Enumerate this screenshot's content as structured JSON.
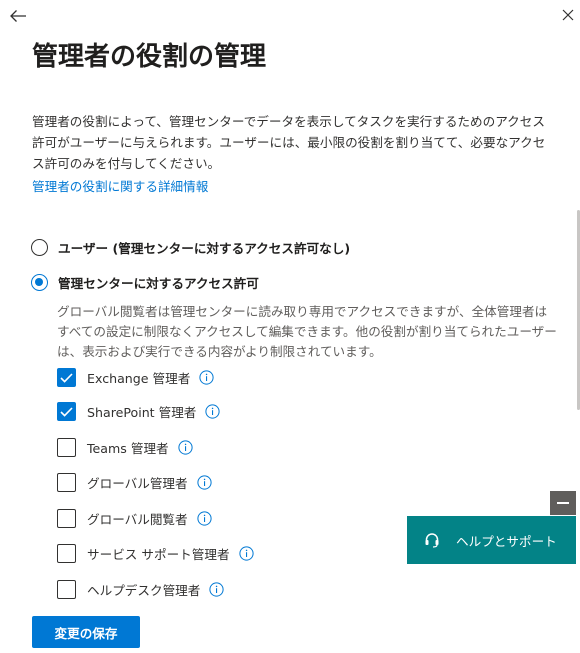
{
  "header": {
    "title": "管理者の役割の管理"
  },
  "description": "管理者の役割によって、管理センターでデータを表示してタスクを実行するためのアクセス許可がユーザーに与えられます。ユーザーには、最小限の役割を割り当てて、必要なアクセス許可のみを付与してください。",
  "learn_more_link": "管理者の役割に関する詳細情報",
  "options": {
    "user_label": "ユーザー (管理センターに対するアクセス許可なし)",
    "admin_label": "管理センターに対するアクセス許可",
    "selected": "admin"
  },
  "admin_description": "グローバル閲覧者は管理センターに読み取り専用でアクセスできますが、全体管理者はすべての設定に制限なくアクセスして編集できます。他の役割が割り当てられたユーザーは、表示および実行できる内容がより制限されています。",
  "roles": [
    {
      "label": "Exchange 管理者",
      "checked": true
    },
    {
      "label": "SharePoint 管理者",
      "checked": true
    },
    {
      "label": "Teams 管理者",
      "checked": false
    },
    {
      "label": "グローバル管理者",
      "checked": false
    },
    {
      "label": "グローバル閲覧者",
      "checked": false
    },
    {
      "label": "サービス サポート管理者",
      "checked": false
    },
    {
      "label": "ヘルプデスク管理者",
      "checked": false
    }
  ],
  "save_label": "変更の保存",
  "help": {
    "label": "ヘルプとサポート"
  },
  "colors": {
    "accent": "#0078d4",
    "help_bg": "#038387"
  },
  "icons": {
    "back": "back-arrow-icon",
    "close": "close-icon",
    "info": "info-icon",
    "headset": "headset-icon",
    "minimize": "minimize-icon"
  }
}
